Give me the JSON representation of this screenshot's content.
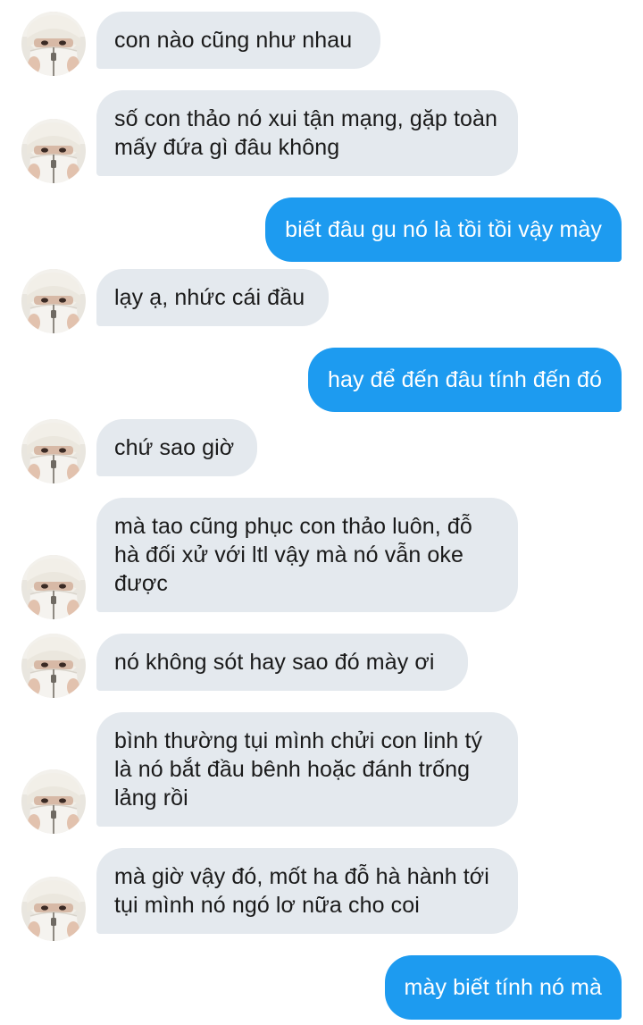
{
  "conversation": {
    "contact_avatar_icon": "avatar-person-in-white-hood",
    "colors": {
      "incoming_bubble": "#e4e9ee",
      "outgoing_bubble": "#1d9bf0",
      "incoming_text": "#1a1a1a",
      "outgoing_text": "#ffffff"
    },
    "messages": [
      {
        "direction": "in",
        "text": "con nào cũng như nhau"
      },
      {
        "direction": "in",
        "text": "số con thảo nó xui tận mạng, gặp toàn mấy đứa gì đâu không"
      },
      {
        "direction": "out",
        "text": "biết đâu gu nó là tồi tồi vậy mày"
      },
      {
        "direction": "in",
        "text": "lạy ạ, nhức cái đầu"
      },
      {
        "direction": "out",
        "text": "hay để đến đâu tính đến đó"
      },
      {
        "direction": "in",
        "text": "chứ sao giờ"
      },
      {
        "direction": "in",
        "text": "mà tao cũng phục con thảo luôn, đỗ hà đối xử với ltl vậy mà nó vẫn oke được"
      },
      {
        "direction": "in",
        "text": "nó không sót hay sao đó mày ơi"
      },
      {
        "direction": "in",
        "text": "bình thường tụi mình chửi con linh tý là nó bắt đầu bênh hoặc đánh trống lảng rồi"
      },
      {
        "direction": "in",
        "text": "mà giờ vậy đó, mốt ha đỗ hà hành tới tụi mình nó ngó lơ nữa cho coi"
      },
      {
        "direction": "out",
        "text": "mày biết tính nó mà"
      }
    ]
  }
}
